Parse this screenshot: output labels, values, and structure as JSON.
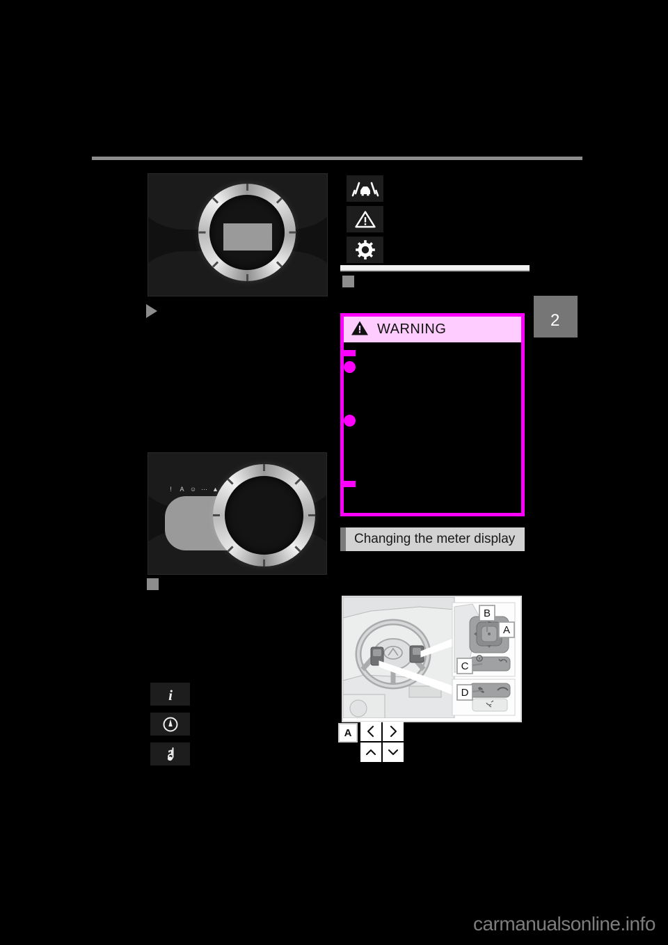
{
  "page": {
    "background": "#000000",
    "chapter_tab": "2",
    "watermark": "carmanualsonline.info",
    "rule_color": "#8d8d8d"
  },
  "left_column": {
    "meter_image_1": {
      "name": "instrument-cluster-centered-gauge",
      "lcd_label": ""
    },
    "triangle_marker": "",
    "meter_image_2": {
      "name": "instrument-cluster-offset-gauge",
      "telltale_count": 6
    },
    "square_marker": "",
    "display_icons": [
      {
        "id": "information-icon",
        "glyph": "i",
        "label": ""
      },
      {
        "id": "gauge-icon",
        "glyph": "gauge",
        "label": ""
      },
      {
        "id": "audio-note-icon",
        "glyph": "note",
        "label": ""
      }
    ]
  },
  "right_column": {
    "status_icons": [
      {
        "id": "lane-departure-icon",
        "label": ""
      },
      {
        "id": "master-warning-icon",
        "label": ""
      },
      {
        "id": "gear-settings-icon",
        "label": ""
      }
    ],
    "light_header": {
      "title": "",
      "bullet": ""
    },
    "warning_box": {
      "title": "WARNING",
      "icon": "warning-triangle-icon",
      "border_color": "#ff00ff",
      "header_color": "#ffccff",
      "markers": [
        {
          "type": "square",
          "text": ""
        },
        {
          "type": "dot",
          "text": ""
        },
        {
          "type": "dot",
          "text": ""
        },
        {
          "type": "square",
          "text": ""
        }
      ]
    },
    "section_header": {
      "title": "Changing the meter display",
      "bar_color": "#d2d2d2",
      "accent_color": "#7a7a7a"
    },
    "steering_diagram": {
      "name": "steering-wheel-switch-diagram",
      "callouts": [
        {
          "id": "callout-a",
          "label": "A"
        },
        {
          "id": "callout-b",
          "label": "B"
        },
        {
          "id": "callout-c",
          "label": "C"
        },
        {
          "id": "callout-d",
          "label": "D"
        }
      ]
    },
    "control_legend": {
      "group_label": "A",
      "buttons": [
        {
          "id": "chevron-left-button",
          "glyph": "‹"
        },
        {
          "id": "chevron-right-button",
          "glyph": "›"
        },
        {
          "id": "chevron-up-button",
          "glyph": "˄"
        },
        {
          "id": "chevron-down-button",
          "glyph": "˅"
        }
      ]
    }
  }
}
